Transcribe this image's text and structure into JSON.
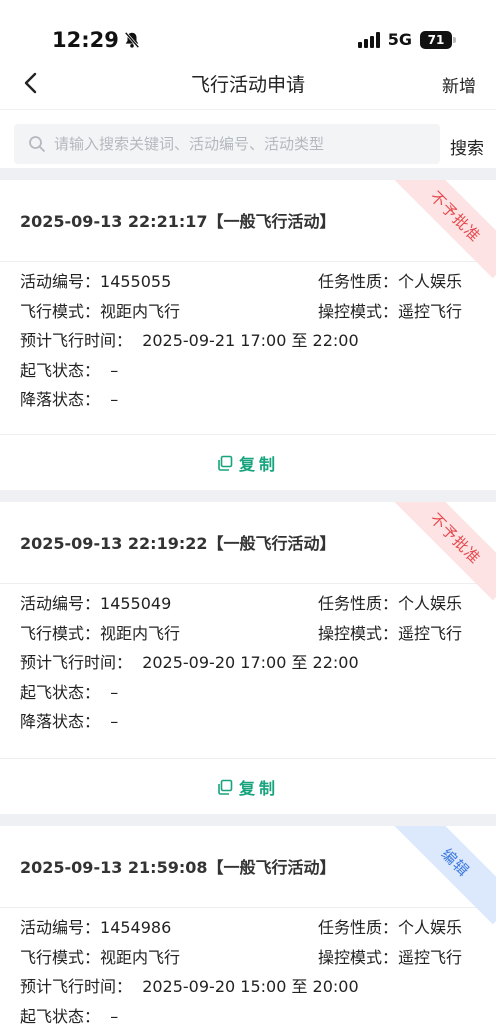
{
  "status": {
    "time": "12:29",
    "network": "5G",
    "battery": "71"
  },
  "nav": {
    "title": "飞行活动申请",
    "add_label": "新增"
  },
  "search": {
    "placeholder": "请输入搜索关键词、活动编号、活动类型",
    "button_label": "搜索"
  },
  "labels": {
    "activity_no": "活动编号：",
    "task_nature": "任务性质：",
    "flight_mode": "飞行模式：",
    "control_mode": "操控模式：",
    "planned_time": "预计飞行时间：",
    "takeoff_status": "起飞状态：",
    "landing_status": "降落状态："
  },
  "cards": [
    {
      "header": "2025-09-13 22:21:17【一般飞行活动】",
      "badge": "不予批准",
      "badge_color": "#e5484d",
      "activity_no": "1455055",
      "task_nature": "个人娱乐",
      "flight_mode": "视距内飞行",
      "control_mode": "遥控飞行",
      "planned_time": "2025-09-21 17:00 至 22:00",
      "takeoff_status": "–",
      "landing_status": "–",
      "action": "复制"
    },
    {
      "header": "2025-09-13 22:19:22【一般飞行活动】",
      "badge": "不予批准",
      "badge_color": "#e5484d",
      "activity_no": "1455049",
      "task_nature": "个人娱乐",
      "flight_mode": "视距内飞行",
      "control_mode": "遥控飞行",
      "planned_time": "2025-09-20 17:00 至 22:00",
      "takeoff_status": "–",
      "landing_status": "–",
      "action": "复制"
    },
    {
      "header": "2025-09-13 21:59:08【一般飞行活动】",
      "badge": "编辑",
      "badge_color": "#3d7be0",
      "activity_no": "1454986",
      "task_nature": "个人娱乐",
      "flight_mode": "视距内飞行",
      "control_mode": "遥控飞行",
      "planned_time": "2025-09-20 15:00 至 20:00",
      "takeoff_status": "–"
    }
  ]
}
